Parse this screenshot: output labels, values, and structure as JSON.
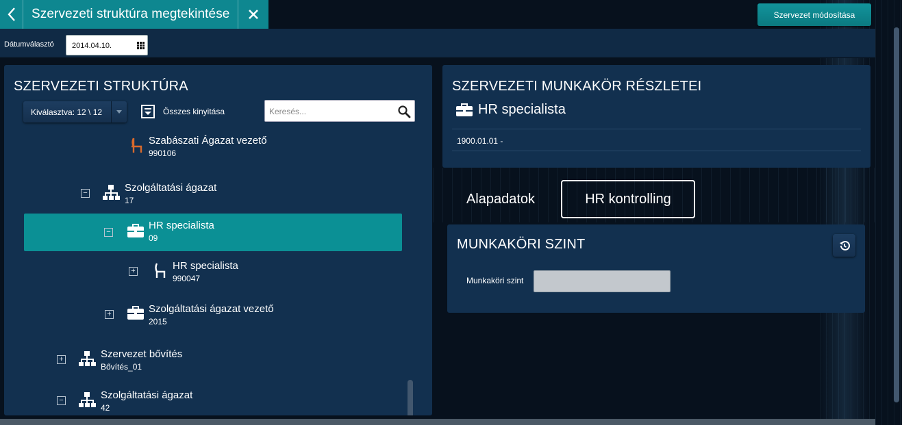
{
  "header": {
    "title": "Szervezeti struktúra megtekintése",
    "modify_button": "Szervezet módosítása"
  },
  "date_picker": {
    "label": "Dátumválasztó",
    "value": "2014.04.10."
  },
  "structure_panel": {
    "heading": "SZERVEZETI STRUKTÚRA",
    "selected_label": "Kiválasztva: 12 \\ 12",
    "expand_all_label": "Összes kinyitása",
    "search_placeholder": "Keresés...",
    "tree": [
      {
        "name": "Szabászati  Ágazat vezető",
        "code": "990106",
        "icon": "chair-icon",
        "icon_color": "#d96a2c",
        "toggle": null
      },
      {
        "name": "Szolgáltatási ágazat",
        "code": "17",
        "icon": "org-chart-icon",
        "toggle": "−"
      },
      {
        "name": "HR specialista",
        "code": "09",
        "icon": "briefcase-icon",
        "toggle": "−",
        "selected": true
      },
      {
        "name": "HR specialista",
        "code": "990047",
        "icon": "chair-icon",
        "icon_color": "#ffffff",
        "toggle": "+"
      },
      {
        "name": "Szolgáltatási ágazat vezető",
        "code": "2015",
        "icon": "briefcase-icon",
        "toggle": "+"
      },
      {
        "name": "Szervezet bővítés",
        "code": "Bővítés_01",
        "icon": "org-chart-icon",
        "toggle": "+"
      },
      {
        "name": "Szolgáltatási ágazat",
        "code": "42",
        "icon": "org-chart-icon",
        "toggle": "−"
      }
    ]
  },
  "details_panel": {
    "heading": "SZERVEZETI MUNKAKÖR RÉSZLETEI",
    "job_title": "HR specialista",
    "date_range": "1900.01.01  -"
  },
  "tabs": [
    {
      "label": "Alapadatok",
      "active": false
    },
    {
      "label": "HR kontrolling",
      "active": true
    }
  ],
  "level_panel": {
    "heading": "MUNKAKÖRI SZINT",
    "field_label": "Munkaköri szint",
    "field_value": ""
  },
  "colors": {
    "accent": "#0e8790",
    "selected_row": "#0b9095",
    "panel": "#12304f",
    "background": "#07111d"
  }
}
